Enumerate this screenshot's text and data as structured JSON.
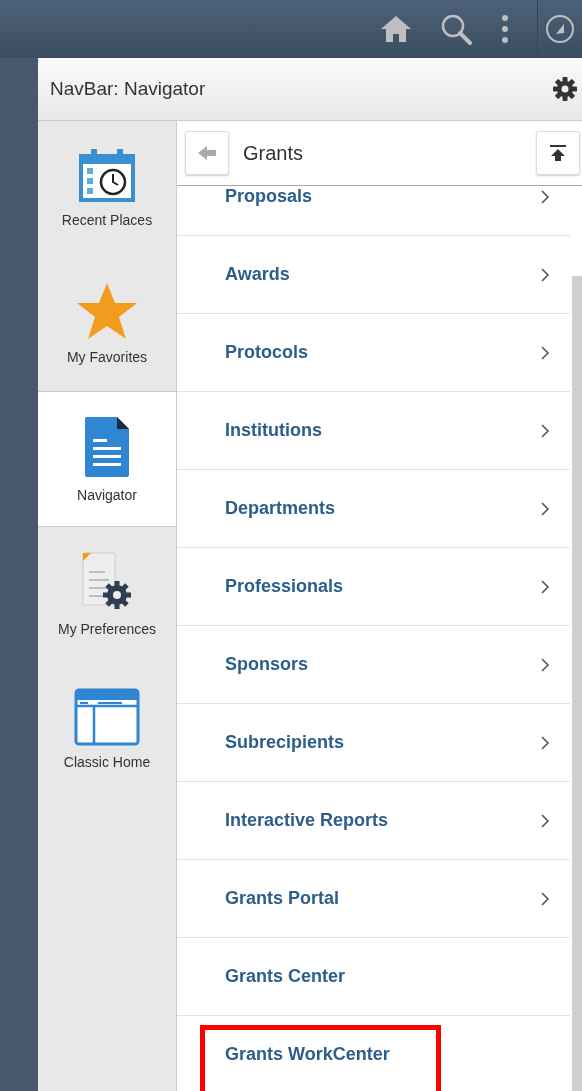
{
  "panel": {
    "title": "NavBar: Navigator"
  },
  "sidebar": {
    "items": [
      {
        "label": "Recent Places",
        "kind": "recent",
        "selected": false
      },
      {
        "label": "My Favorites",
        "kind": "favorites",
        "selected": false
      },
      {
        "label": "Navigator",
        "kind": "navigator",
        "selected": true
      },
      {
        "label": "My Preferences",
        "kind": "preferences",
        "selected": false
      },
      {
        "label": "Classic Home",
        "kind": "classic",
        "selected": false
      }
    ]
  },
  "folder": {
    "title": "Grants"
  },
  "items": [
    {
      "label": "Proposals",
      "submenu": true,
      "highlighted": false
    },
    {
      "label": "Awards",
      "submenu": true,
      "highlighted": false
    },
    {
      "label": "Protocols",
      "submenu": true,
      "highlighted": false
    },
    {
      "label": "Institutions",
      "submenu": true,
      "highlighted": false
    },
    {
      "label": "Departments",
      "submenu": true,
      "highlighted": false
    },
    {
      "label": "Professionals",
      "submenu": true,
      "highlighted": false
    },
    {
      "label": "Sponsors",
      "submenu": true,
      "highlighted": false
    },
    {
      "label": "Subrecipients",
      "submenu": true,
      "highlighted": false
    },
    {
      "label": "Interactive Reports",
      "submenu": true,
      "highlighted": false
    },
    {
      "label": "Grants Portal",
      "submenu": true,
      "highlighted": false
    },
    {
      "label": "Grants Center",
      "submenu": false,
      "highlighted": false
    },
    {
      "label": "Grants WorkCenter",
      "submenu": false,
      "highlighted": true
    }
  ]
}
